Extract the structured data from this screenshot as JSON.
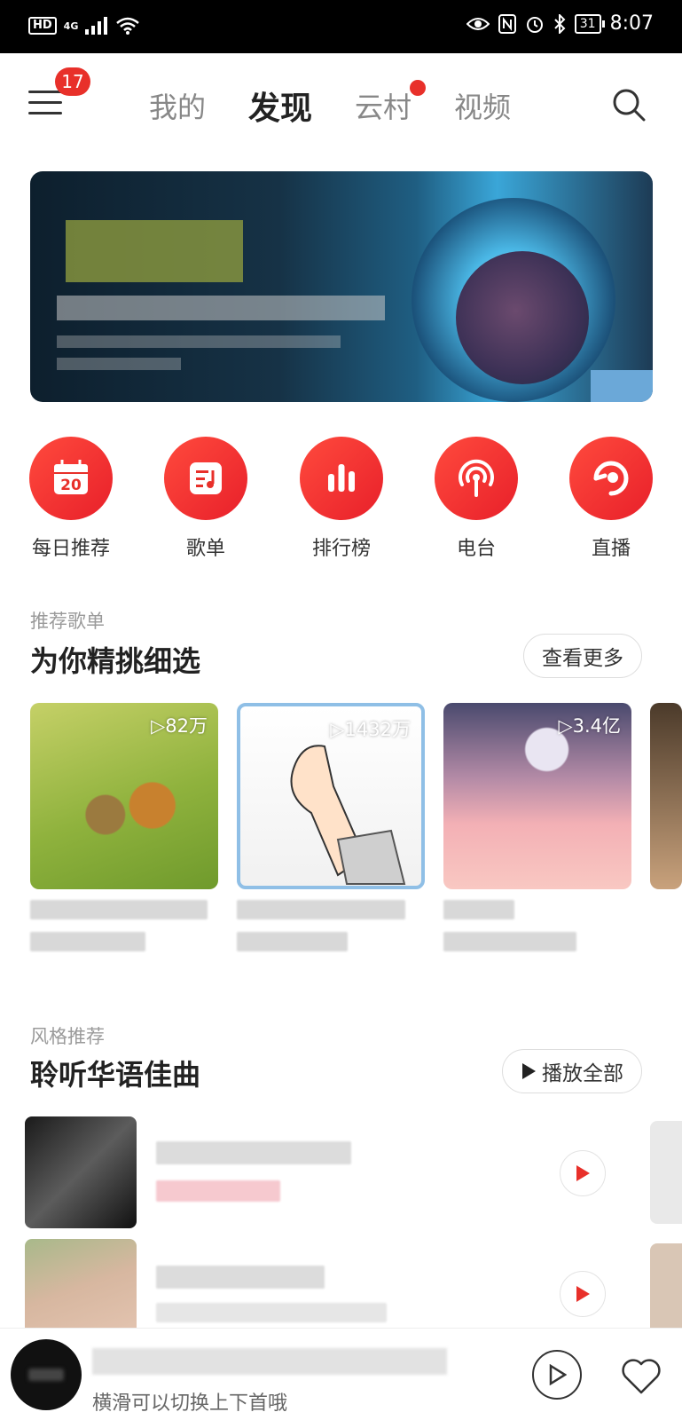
{
  "status_bar": {
    "hd": "HD",
    "network": "4G",
    "battery": "31",
    "time": "8:07"
  },
  "nav": {
    "menu_badge": "17",
    "tabs": [
      {
        "label": "我的",
        "active": false,
        "dot": false
      },
      {
        "label": "发现",
        "active": true,
        "dot": false
      },
      {
        "label": "云村",
        "active": false,
        "dot": true
      },
      {
        "label": "视频",
        "active": false,
        "dot": false
      }
    ]
  },
  "quick_entries": [
    {
      "label": "每日推荐",
      "icon": "calendar-icon",
      "icon_text": "20"
    },
    {
      "label": "歌单",
      "icon": "playlist-icon"
    },
    {
      "label": "排行榜",
      "icon": "chart-bars-icon"
    },
    {
      "label": "电台",
      "icon": "radio-podcast-icon"
    },
    {
      "label": "直播",
      "icon": "live-icon"
    }
  ],
  "recommended": {
    "subtitle": "推荐歌单",
    "title": "为你精挑细选",
    "more_label": "查看更多",
    "playlists": [
      {
        "plays": "82万"
      },
      {
        "plays": "1432万"
      },
      {
        "plays": "3.4亿"
      }
    ]
  },
  "style_section": {
    "subtitle": "风格推荐",
    "title": "聆听华语佳曲",
    "play_all_label": "播放全部"
  },
  "mini_player": {
    "hint": "横滑可以切换上下首哦"
  },
  "colors": {
    "accent": "#e8302a",
    "text_primary": "#222222",
    "text_secondary": "#9a9a9a"
  }
}
